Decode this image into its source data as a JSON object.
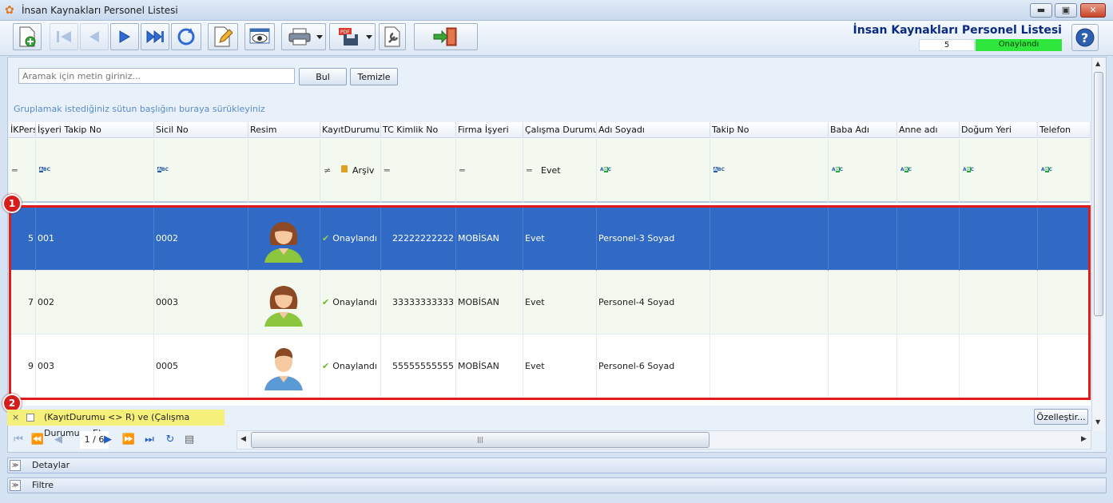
{
  "window": {
    "title": "İnsan Kaynakları Personel Listesi"
  },
  "header": {
    "app_title": "İnsan Kaynakları Personel Listesi",
    "record_count": "5",
    "status": "Onaylandı"
  },
  "search": {
    "placeholder": "Aramak için metin giriniz...",
    "find_label": "Bul",
    "clear_label": "Temizle"
  },
  "group_hint": "Gruplamak istediğiniz sütun başlığını buraya sürükleyiniz",
  "columns": [
    {
      "key": "ikpers",
      "label": "İKPers"
    },
    {
      "key": "isyeri_takip",
      "label": "İşyeri Takip No"
    },
    {
      "key": "sicil",
      "label": "Sicil No"
    },
    {
      "key": "resim",
      "label": "Resim"
    },
    {
      "key": "kayit_durumu",
      "label": "KayıtDurumu"
    },
    {
      "key": "tc",
      "label": "TC Kimlik No"
    },
    {
      "key": "firma",
      "label": "Firma İşyeri"
    },
    {
      "key": "calisma",
      "label": "Çalışma Durumu"
    },
    {
      "key": "ad_soyad",
      "label": "Adı Soyadı"
    },
    {
      "key": "takip",
      "label": "Takip No"
    },
    {
      "key": "baba",
      "label": "Baba Adı"
    },
    {
      "key": "anne",
      "label": "Anne adı"
    },
    {
      "key": "dogum_yeri",
      "label": "Doğum Yeri"
    },
    {
      "key": "telefon",
      "label": "Telefon"
    }
  ],
  "filter_row": {
    "kayit_durumu": "Arşiv",
    "calisma": "Evet"
  },
  "rows": [
    {
      "ikpers": "5",
      "isyeri_takip": "001",
      "sicil": "0002",
      "avatar": "female-avatar",
      "kayit_durumu": "Onaylandı",
      "tc": "22222222222",
      "firma": "MOBİSAN",
      "calisma": "Evet",
      "ad_soyad": "Personel-3 Soyad",
      "selected": true
    },
    {
      "ikpers": "7",
      "isyeri_takip": "002",
      "sicil": "0003",
      "avatar": "female-avatar",
      "kayit_durumu": "Onaylandı",
      "tc": "33333333333",
      "firma": "MOBİSAN",
      "calisma": "Evet",
      "ad_soyad": "Personel-4 Soyad",
      "selected": false
    },
    {
      "ikpers": "9",
      "isyeri_takip": "003",
      "sicil": "0005",
      "avatar": "male-avatar",
      "kayit_durumu": "Onaylandı",
      "tc": "55555555555",
      "firma": "MOBİSAN",
      "calisma": "Evet",
      "ad_soyad": "Personel-6 Soyad",
      "selected": false
    }
  ],
  "annotations": {
    "badge1": "1",
    "badge2": "2"
  },
  "filter_bar": {
    "close": "×",
    "expression": "(KayıtDurumu <> R) ve (Çalışma Durumu = E)",
    "customize_label": "Özelleştir..."
  },
  "navigator": {
    "page": "1 / 6"
  },
  "panels": {
    "details": "Detaylar",
    "filter": "Filtre"
  },
  "colors": {
    "selected_row": "#316ac5",
    "status_green": "#2ee63c",
    "highlight_red": "#e21a1a",
    "title_blue": "#0b2a82"
  }
}
